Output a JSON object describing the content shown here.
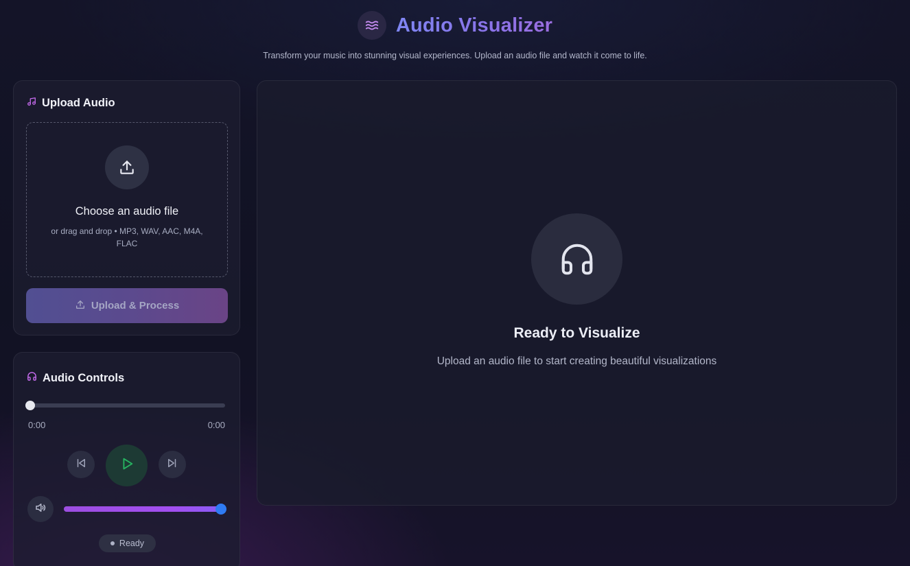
{
  "header": {
    "logo_icon": "waves-icon",
    "title": "Audio Visualizer",
    "subtitle": "Transform your music into stunning visual experiences. Upload an audio file and watch it come to life."
  },
  "upload": {
    "heading": "Upload Audio",
    "heading_icon": "music-note-icon",
    "dropzone": {
      "icon": "upload-icon",
      "title": "Choose an audio file",
      "hint": "or drag and drop • MP3, WAV, AAC, M4A, FLAC"
    },
    "button_label": "Upload & Process",
    "button_icon": "upload-icon"
  },
  "controls": {
    "heading": "Audio Controls",
    "heading_icon": "headphones-icon",
    "progress": 0,
    "current_time": "0:00",
    "total_time": "0:00",
    "prev_icon": "skip-back-icon",
    "play_icon": "play-icon",
    "next_icon": "skip-forward-icon",
    "volume_icon": "volume-icon",
    "volume": 1.0,
    "status": "Ready"
  },
  "visualizer": {
    "icon": "headphones-icon",
    "title": "Ready to Visualize",
    "hint": "Upload an audio file to start creating beautiful visualizations"
  },
  "colors": {
    "accent_purple": "#a24ff0",
    "title_gradient_start": "#7f86f3",
    "play_green": "#22c55e",
    "volume_thumb": "#2f7bf3"
  }
}
